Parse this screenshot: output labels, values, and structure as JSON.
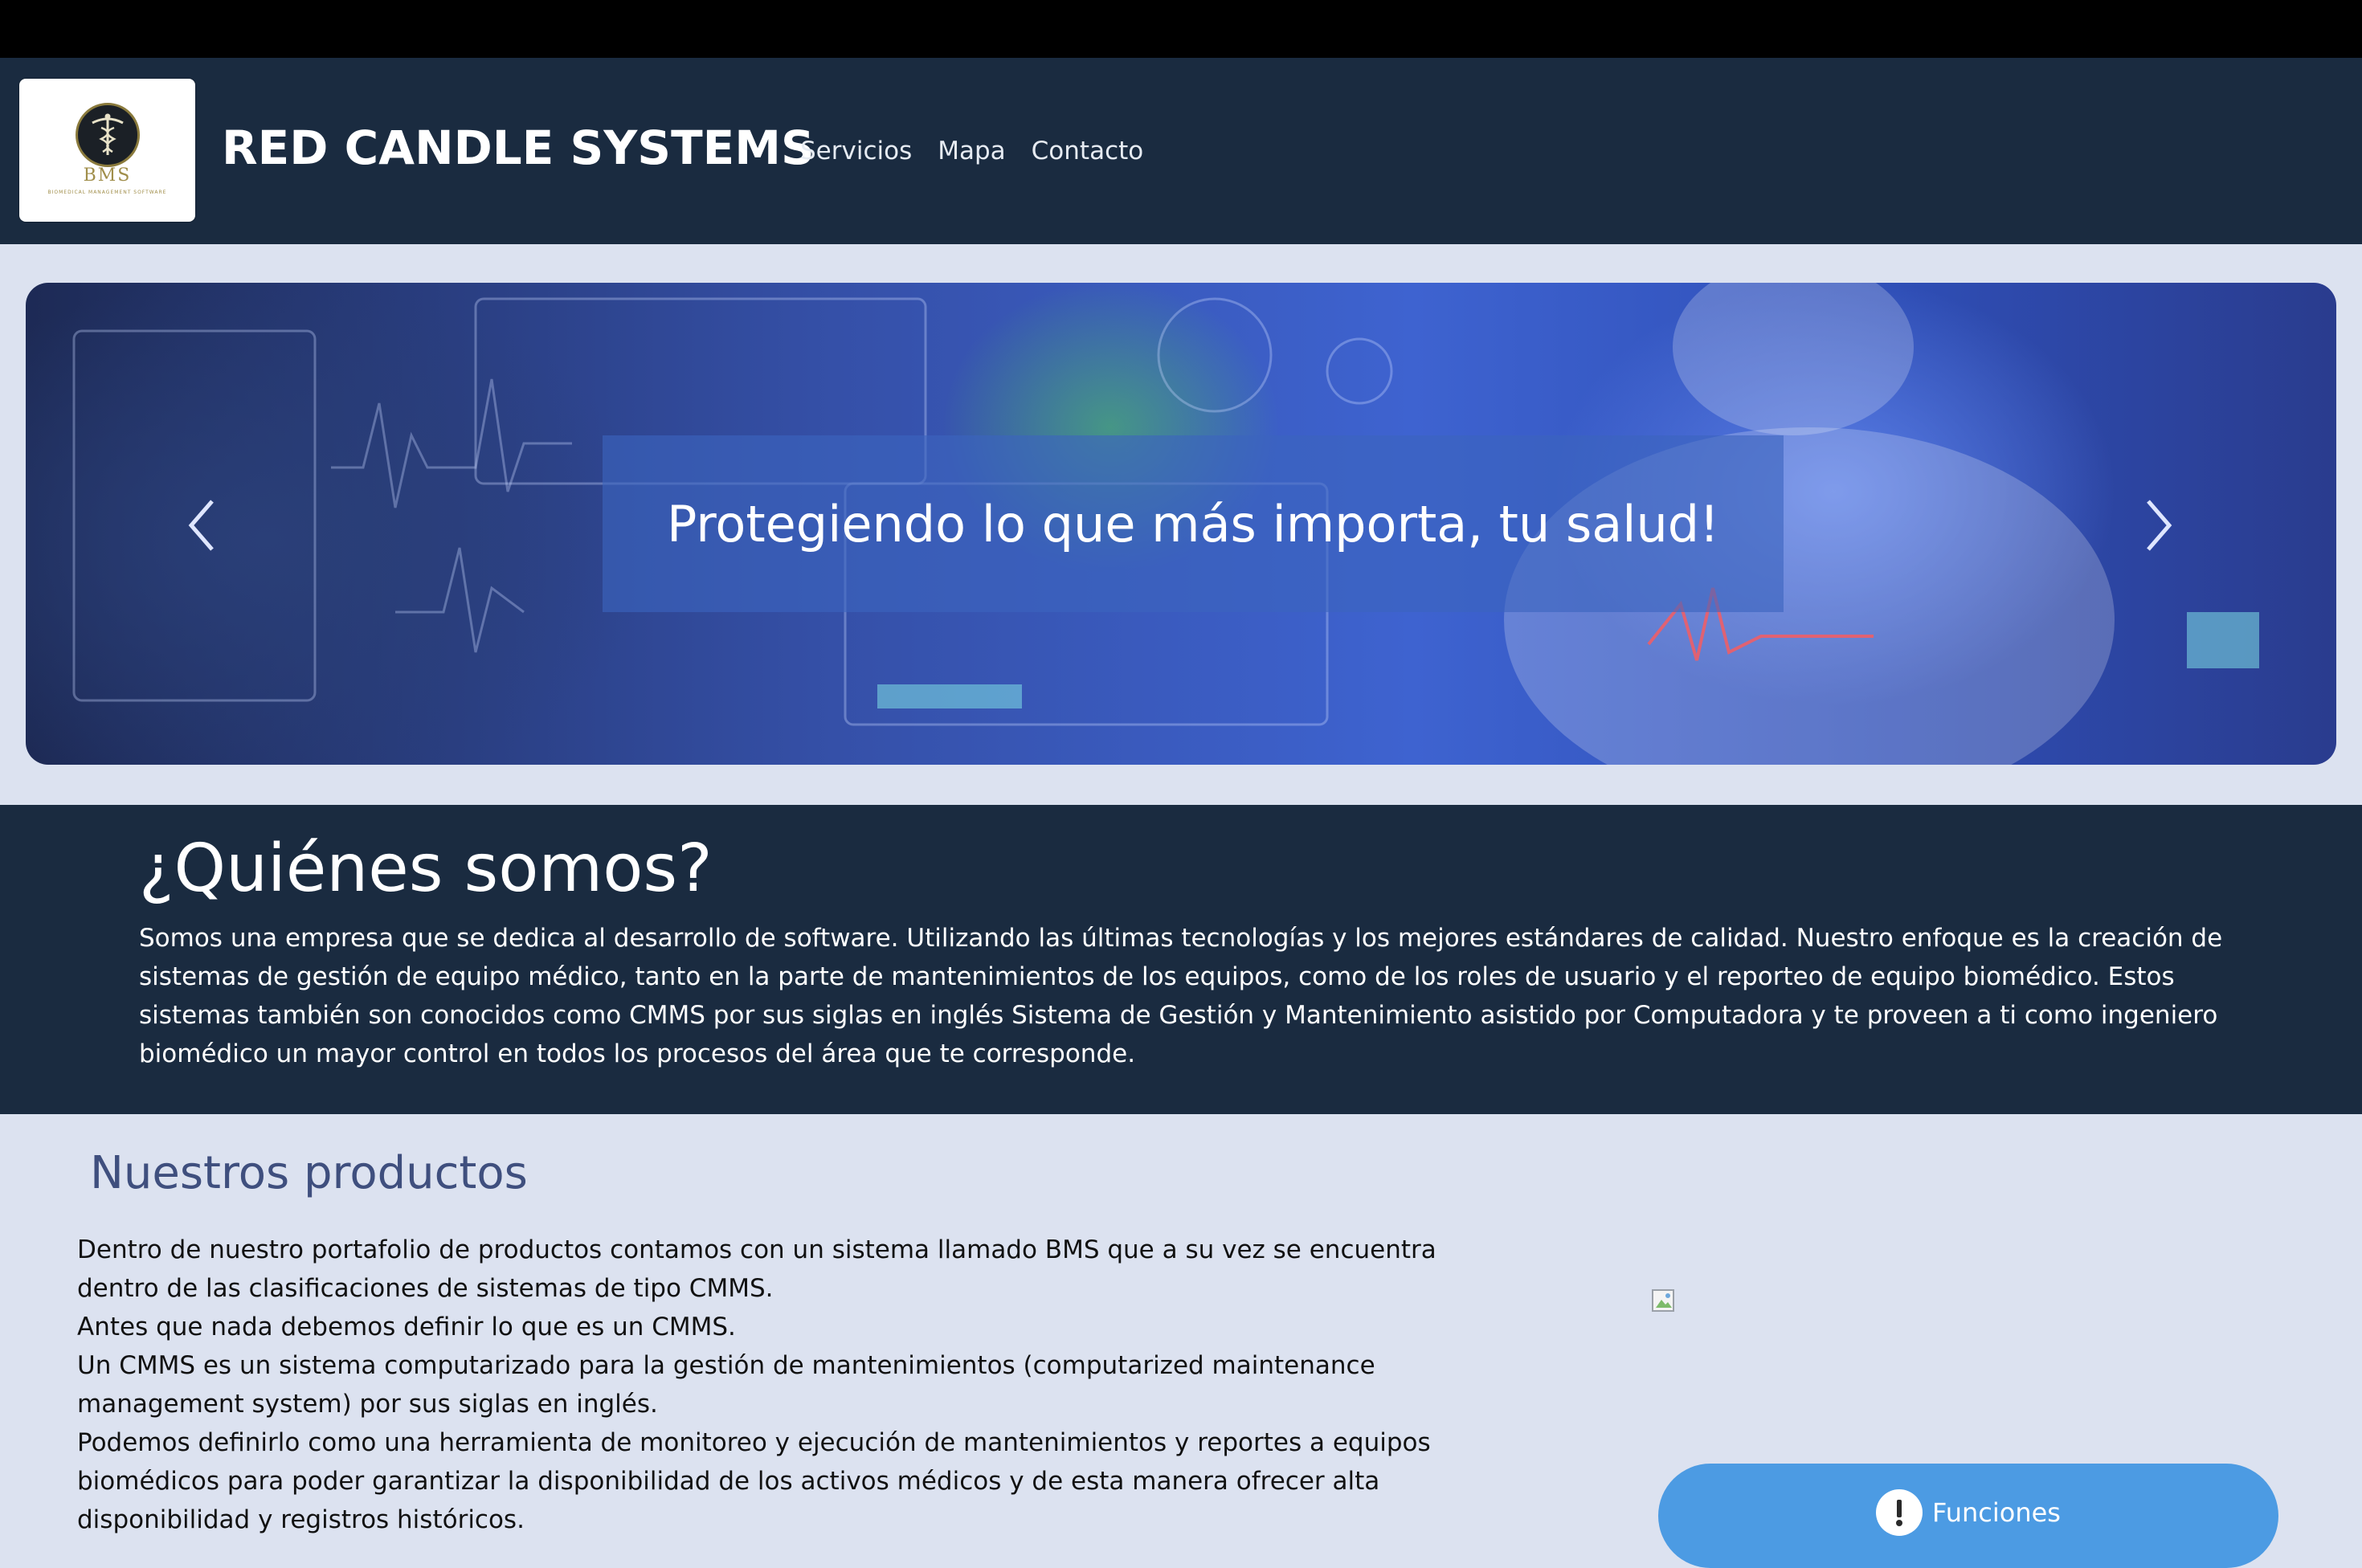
{
  "header": {
    "logo_text": "BMS",
    "logo_sub": "BIOMEDICAL MANAGEMENT SOFTWARE",
    "brand": "RED CANDLE SYSTEMS",
    "nav": [
      {
        "label": "Servicios"
      },
      {
        "label": "Mapa"
      },
      {
        "label": "Contacto"
      }
    ]
  },
  "carousel": {
    "caption": "Protegiendo lo que más importa, tu salud!",
    "prev_icon": "chevron-left-icon",
    "next_icon": "chevron-right-icon"
  },
  "about": {
    "title": "¿Quiénes somos?",
    "body": "Somos una empresa que se dedica al desarrollo de software. Utilizando las últimas tecnologías y los mejores estándares de calidad. Nuestro enfoque es la creación de sistemas de gestión de equipo médico, tanto en la parte de mantenimientos de los equipos, como de los roles de usuario y el reporteo de equipo biomédico. Estos sistemas también son conocidos como CMMS por sus siglas en inglés Sistema de Gestión y Mantenimiento asistido por Computadora y te proveen a ti como ingeniero biomédico un mayor control en todos los procesos del área que te corresponde."
  },
  "products": {
    "title": "Nuestros productos",
    "paragraphs": [
      "Dentro de nuestro portafolio de productos contamos con un sistema llamado BMS que a su vez se encuentra dentro de las clasificaciones de sistemas de tipo CMMS.",
      "Antes que nada debemos definir lo que es un CMMS.",
      "Un CMMS es un sistema computarizado para la gestión de mantenimientos (computarized maintenance management system) por sus siglas en inglés.",
      "Podemos definirlo como una herramienta de monitoreo y ejecución de mantenimientos y reportes a equipos biomédicos para poder garantizar la disponibilidad de los activos médicos y de esta manera ofrecer alta disponibilidad y registros históricos."
    ],
    "button_label": "Funciones",
    "button_icon": "info-icon"
  },
  "colors": {
    "header_bg": "#1a2b40",
    "page_bg": "#dce2f0",
    "accent": "#4c9be3",
    "products_title": "#3f4f7e"
  }
}
